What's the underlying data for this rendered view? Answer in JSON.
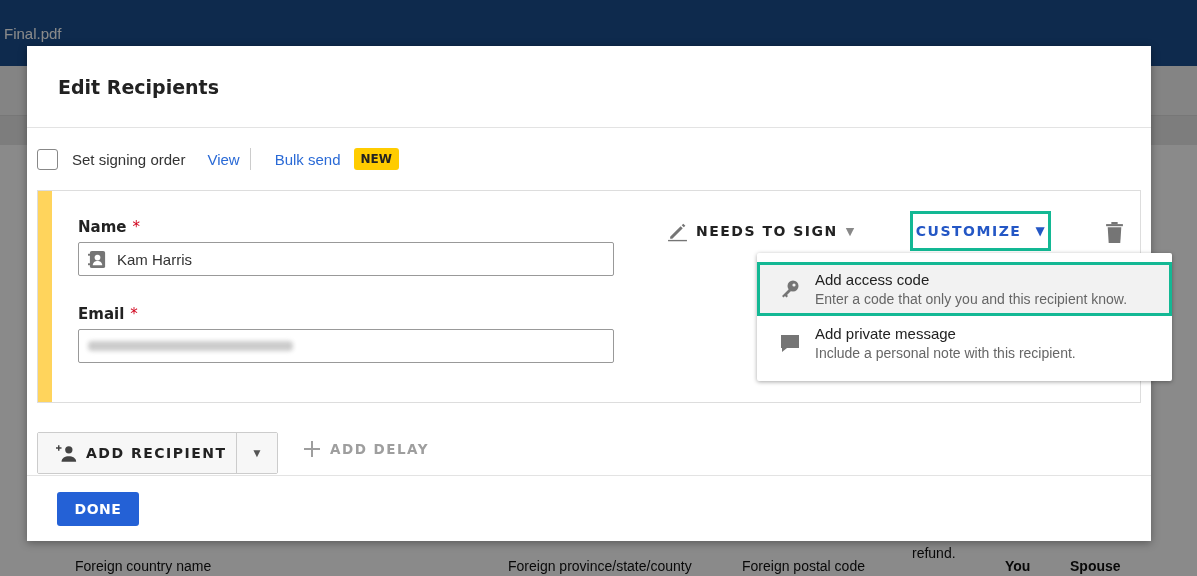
{
  "app_bar": {
    "file_name": "Final.pdf"
  },
  "document": {
    "texts": [
      "Foreign country name",
      "Foreign province/state/county",
      "Foreign postal code",
      "refund.",
      "You",
      "Spouse"
    ]
  },
  "dialog": {
    "title": "Edit Recipients",
    "signing_order": {
      "label": "Set signing order",
      "checked": false
    },
    "view_link": "View",
    "bulk_send": "Bulk send",
    "new_badge": "NEW",
    "recipient": {
      "color": "#ffd45c",
      "name_label": "Name",
      "email_label": "Email",
      "required_mark": "*",
      "name_value": "Kam Harris",
      "role": "NEEDS TO SIGN",
      "customize": "CUSTOMIZE",
      "customize_caret": "▼",
      "role_caret": "▼"
    },
    "customize_menu": [
      {
        "kind": "key",
        "title": "Add access code",
        "description": "Enter a code that only you and this recipient know.",
        "selected": true
      },
      {
        "kind": "message",
        "title": "Add private message",
        "description": "Include a personal note with this recipient.",
        "selected": false
      }
    ],
    "add_recipient": "ADD RECIPIENT",
    "add_recipient_caret": "▼",
    "add_delay": "ADD DELAY",
    "done": "DONE"
  }
}
